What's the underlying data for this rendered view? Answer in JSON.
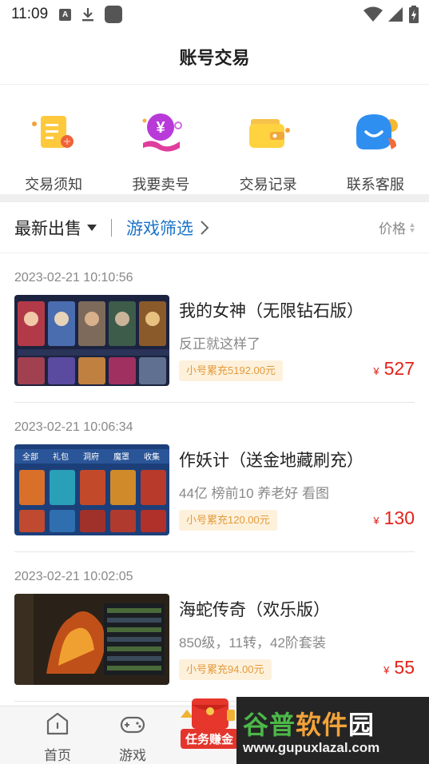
{
  "status_bar": {
    "time": "11:09",
    "icons": [
      "a-notification-icon",
      "download-icon",
      "app-square-icon",
      "wifi-icon",
      "signal-icon",
      "battery-charging-icon"
    ],
    "notification_letter": "A"
  },
  "header": {
    "title": "账号交易"
  },
  "quick_menu": [
    {
      "label": "交易须知",
      "icon": "notice-document-icon"
    },
    {
      "label": "我要卖号",
      "icon": "sell-yen-icon"
    },
    {
      "label": "交易记录",
      "icon": "wallet-icon"
    },
    {
      "label": "联系客服",
      "icon": "customer-service-icon"
    }
  ],
  "filter": {
    "latest_label": "最新出售",
    "game_filter_label": "游戏筛选",
    "price_label": "价格",
    "game_filter_color": "#1a73c8"
  },
  "listings": [
    {
      "date": "2023-02-21 10:10:56",
      "title": "我的女神（无限钻石版）",
      "desc": "反正就这样了",
      "badge": "小号累充5192.00元",
      "price_symbol": "¥",
      "price": "527"
    },
    {
      "date": "2023-02-21 10:06:34",
      "title": "作妖计（送金地藏刷充）",
      "desc": "44亿 榜前10 养老好 看图",
      "badge": "小号累充120.00元",
      "price_symbol": "¥",
      "price": "130",
      "thumb_tabs": [
        "全部",
        "礼包",
        "洞府",
        "魔罩",
        "收集"
      ]
    },
    {
      "date": "2023-02-21 10:02:05",
      "title": "海蛇传奇（欢乐版）",
      "desc": "850级，11转，42阶套装",
      "badge": "小号累充94.00元",
      "price_symbol": "¥",
      "price": "55"
    }
  ],
  "bottom_nav": {
    "items": [
      {
        "label": "首页",
        "icon": "home-icon"
      },
      {
        "label": "游戏",
        "icon": "gamepad-icon"
      }
    ],
    "promo_label": "任务赚金"
  },
  "watermark": {
    "part1": "谷普",
    "part2": "软件",
    "part3": "园",
    "url": "www.gupuxlazal.com"
  },
  "colors": {
    "price": "#e2231a",
    "badge_text": "#e39a3a",
    "badge_bg": "#fdf1dc",
    "accent_blue": "#1a73c8"
  }
}
